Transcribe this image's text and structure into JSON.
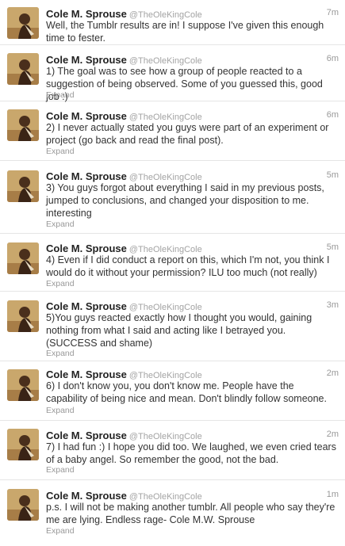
{
  "tweets": [
    {
      "name": "Cole M. Sprouse",
      "handle": "@TheOleKingCole",
      "time": "7m",
      "text": "Well, the Tumblr results are in! I suppose I've given this enough time to fester.",
      "expand": ""
    },
    {
      "name": "Cole M. Sprouse",
      "handle": "@TheOleKingCole",
      "time": "6m",
      "text": "1) The goal was to see how a group of people reacted to a suggestion of being observed. Some of you guessed this, good job :)",
      "expand": "Expand"
    },
    {
      "name": "Cole M. Sprouse",
      "handle": "@TheOleKingCole",
      "time": "6m",
      "text": "2) I never actually stated you guys were part of an experiment or project (go back and read the final post).",
      "expand": "Expand"
    },
    {
      "name": "Cole M. Sprouse",
      "handle": "@TheOleKingCole",
      "time": "5m",
      "text": "3) You guys forgot about everything I said in my previous posts, jumped to conclusions, and changed your disposition to me. interesting",
      "expand": "Expand"
    },
    {
      "name": "Cole M. Sprouse",
      "handle": "@TheOleKingCole",
      "time": "5m",
      "text": "4) Even if I did conduct a report on this, which I'm not, you think I would do it without your permission? ILU too much (not really)",
      "expand": "Expand"
    },
    {
      "name": "Cole M. Sprouse",
      "handle": "@TheOleKingCole",
      "time": "3m",
      "text": "5)You guys reacted exactly how I thought you would, gaining nothing from what I said and acting like I betrayed you. (SUCCESS and shame)",
      "expand": "Expand"
    },
    {
      "name": "Cole M. Sprouse",
      "handle": "@TheOleKingCole",
      "time": "2m",
      "text": "6) I don't know you, you don't know me. People have the capability of being nice and mean. Don't blindly follow someone.",
      "expand": "Expand"
    },
    {
      "name": "Cole M. Sprouse",
      "handle": "@TheOleKingCole",
      "time": "2m",
      "text": "7) I had fun :) I hope you did too. We laughed, we even cried tears of a baby angel. So remember the good, not the bad.",
      "expand": "Expand"
    },
    {
      "name": "Cole M. Sprouse",
      "handle": "@TheOleKingCole",
      "time": "1m",
      "text": "p.s. I will not be making another tumblr. All people who say they're me are lying. Endless rage- Cole M.W. Sprouse",
      "expand": "Expand"
    }
  ]
}
